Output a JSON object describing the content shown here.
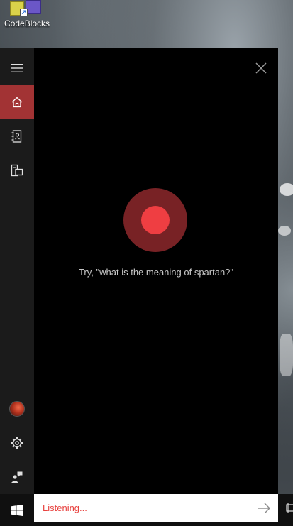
{
  "desktop": {
    "shortcut_label": "CodeBlocks",
    "shortcut_arrow": "↗"
  },
  "rail": {
    "items": [
      {
        "name": "menu",
        "icon": "hamburger-menu-icon"
      },
      {
        "name": "home",
        "icon": "home-icon",
        "active": true
      },
      {
        "name": "notebook",
        "icon": "notebook-icon"
      },
      {
        "name": "devices",
        "icon": "devices-icon"
      },
      {
        "name": "account",
        "icon": "avatar"
      },
      {
        "name": "settings",
        "icon": "gear-icon"
      },
      {
        "name": "feedback",
        "icon": "feedback-icon"
      }
    ]
  },
  "panel": {
    "hint": "Try, \"what is the meaning of spartan?\"",
    "accent": "#a23334",
    "mic_color": "#ef3e42"
  },
  "search": {
    "status_text": "Listening..."
  }
}
